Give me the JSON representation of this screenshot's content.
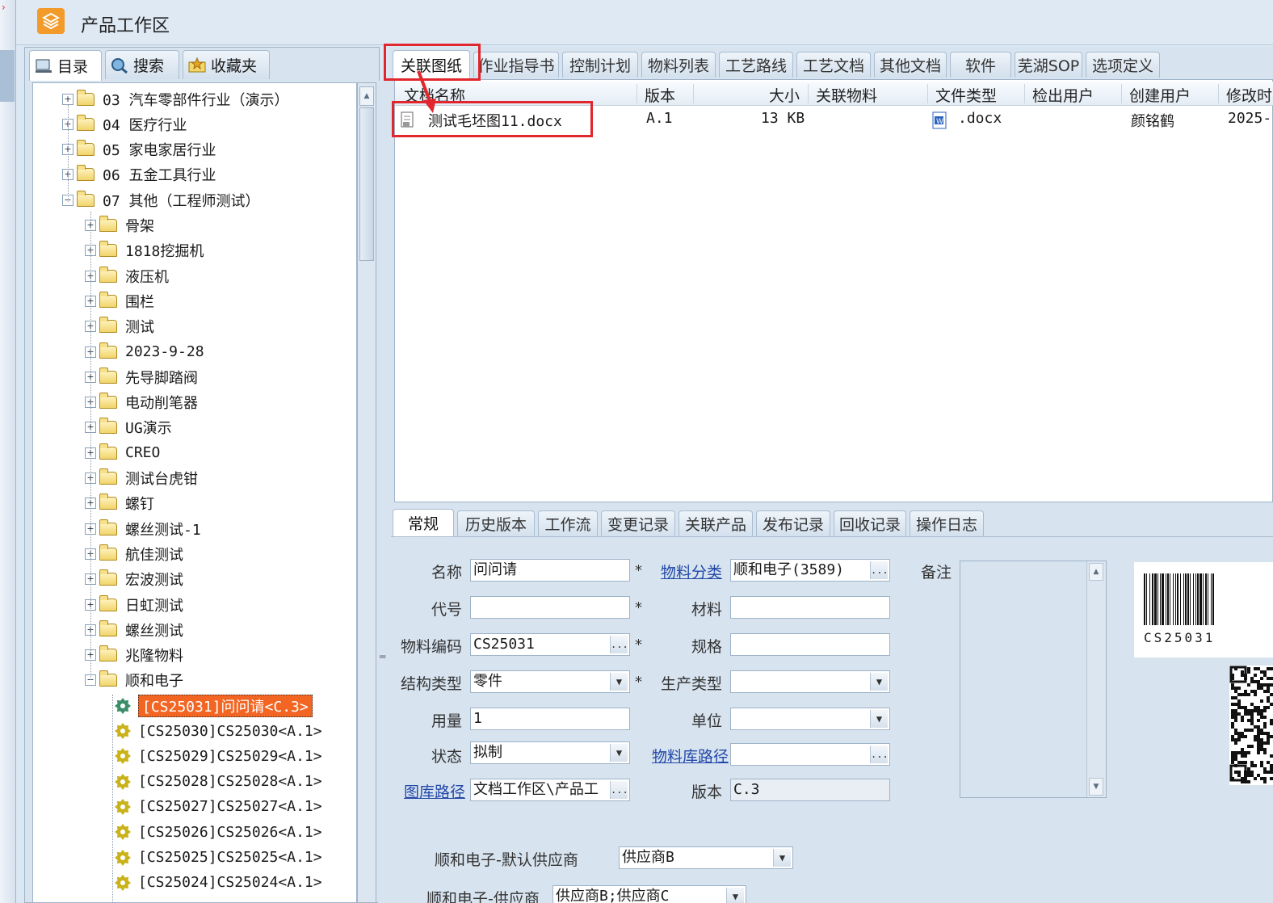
{
  "app": {
    "title": "产品工作区",
    "accent": "#f29a2a"
  },
  "left_tabs": [
    {
      "label": "目录",
      "icon": "catalog-icon"
    },
    {
      "label": "搜索",
      "icon": "search-icon"
    },
    {
      "label": "收藏夹",
      "icon": "favorites-icon"
    }
  ],
  "tree": {
    "items": [
      {
        "level": 1,
        "expander": "+",
        "label": "03 汽车零部件行业（演示）"
      },
      {
        "level": 1,
        "expander": "+",
        "label": "04 医疗行业"
      },
      {
        "level": 1,
        "expander": "+",
        "label": "05 家电家居行业"
      },
      {
        "level": 1,
        "expander": "+",
        "label": "06 五金工具行业"
      },
      {
        "level": 1,
        "expander": "-",
        "label": "07 其他（工程师测试）"
      },
      {
        "level": 2,
        "expander": "+",
        "label": "骨架"
      },
      {
        "level": 2,
        "expander": "+",
        "label": "1818挖掘机"
      },
      {
        "level": 2,
        "expander": "+",
        "label": "液压机"
      },
      {
        "level": 2,
        "expander": "+",
        "label": "围栏"
      },
      {
        "level": 2,
        "expander": "+",
        "label": "测试"
      },
      {
        "level": 2,
        "expander": "+",
        "label": "2023-9-28"
      },
      {
        "level": 2,
        "expander": "+",
        "label": "先导脚踏阀"
      },
      {
        "level": 2,
        "expander": "+",
        "label": "电动削笔器"
      },
      {
        "level": 2,
        "expander": "+",
        "label": "UG演示"
      },
      {
        "level": 2,
        "expander": "+",
        "label": "CREO"
      },
      {
        "level": 2,
        "expander": "+",
        "label": "测试台虎钳"
      },
      {
        "level": 2,
        "expander": "+",
        "label": "螺钉"
      },
      {
        "level": 2,
        "expander": "+",
        "label": "螺丝测试-1"
      },
      {
        "level": 2,
        "expander": "+",
        "label": "航佳测试"
      },
      {
        "level": 2,
        "expander": "+",
        "label": "宏波测试"
      },
      {
        "level": 2,
        "expander": "+",
        "label": "日虹测试"
      },
      {
        "level": 2,
        "expander": "+",
        "label": "螺丝测试"
      },
      {
        "level": 2,
        "expander": "+",
        "label": "兆隆物料"
      },
      {
        "level": 2,
        "expander": "-",
        "label": "顺和电子"
      },
      {
        "level": 3,
        "expander": "",
        "label": "[CS25031]问问请<C.3>",
        "selected": true
      },
      {
        "level": 3,
        "expander": "",
        "label": "[CS25030]CS25030<A.1>"
      },
      {
        "level": 3,
        "expander": "",
        "label": "[CS25029]CS25029<A.1>"
      },
      {
        "level": 3,
        "expander": "",
        "label": "[CS25028]CS25028<A.1>"
      },
      {
        "level": 3,
        "expander": "",
        "label": "[CS25027]CS25027<A.1>"
      },
      {
        "level": 3,
        "expander": "",
        "label": "[CS25026]CS25026<A.1>"
      },
      {
        "level": 3,
        "expander": "",
        "label": "[CS25025]CS25025<A.1>"
      },
      {
        "level": 3,
        "expander": "",
        "label": "[CS25024]CS25024<A.1>"
      }
    ]
  },
  "top_tabs": [
    "关联图纸",
    "作业指导书",
    "控制计划",
    "物料列表",
    "工艺路线",
    "工艺文档",
    "其他文档",
    "软件",
    "芜湖SOP",
    "选项定义"
  ],
  "grid": {
    "columns": [
      "文档名称",
      "版本",
      "大小",
      "关联物料",
      "文件类型",
      "检出用户",
      "创建用户",
      "修改时"
    ],
    "rows": [
      {
        "name": "测试毛坯图11.docx",
        "version": "A.1",
        "size": "13 KB",
        "material": "",
        "file_type": ".docx",
        "checkout_user": "",
        "creator": "颜铭鹤",
        "modified": "2025-"
      }
    ]
  },
  "bottom_tabs": [
    "常规",
    "历史版本",
    "工作流",
    "变更记录",
    "关联产品",
    "发布记录",
    "回收记录",
    "操作日志"
  ],
  "form": {
    "name_label": "名称",
    "name_value": "问问请",
    "code_label": "代号",
    "code_value": "",
    "material_code_label": "物料编码",
    "material_code_value": "CS25031",
    "structure_label": "结构类型",
    "structure_value": "零件",
    "qty_label": "用量",
    "qty_value": "1",
    "status_label": "状态",
    "status_value": "拟制",
    "lib_path_label": "图库路径",
    "lib_path_value": "文档工作区\\产品工",
    "category_label": "物料分类",
    "category_value": "顺和电子(3589)",
    "material_label": "材料",
    "material_value": "",
    "spec_label": "规格",
    "spec_value": "",
    "prod_type_label": "生产类型",
    "prod_type_value": "",
    "unit_label": "单位",
    "unit_value": "",
    "mat_lib_label": "物料库路径",
    "mat_lib_value": "",
    "version_label": "版本",
    "version_value": "C.3",
    "remark_label": "备注",
    "supplier_default_label": "顺和电子-默认供应商",
    "supplier_default_value": "供应商B",
    "supplier_label": "顺和电子-供应商",
    "supplier_value": "供应商B;供应商C",
    "required": "*",
    "ellipsis": "...",
    "barcode_text": "CS25031"
  }
}
